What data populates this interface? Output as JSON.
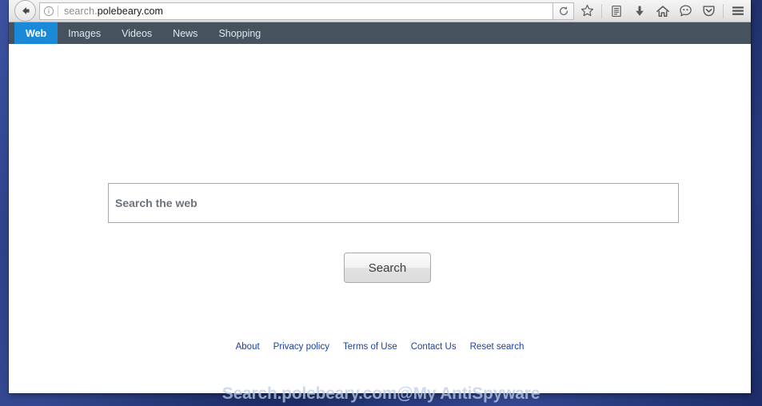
{
  "browser": {
    "back_label": "Back",
    "url_prefix": "search.",
    "url_domain": "polebeary.com",
    "url_full": "search.polebeary.com",
    "identity_icon": "info-circle-icon",
    "reload_icon": "reload-icon",
    "toolbar_icons": [
      {
        "name": "bookmark-star-icon",
        "label": "Bookmark this page"
      },
      {
        "name": "library-icon",
        "label": "Show your library"
      },
      {
        "name": "downloads-icon",
        "label": "Downloads"
      },
      {
        "name": "home-icon",
        "label": "Home"
      },
      {
        "name": "sync-icon",
        "label": "Sync"
      },
      {
        "name": "pocket-icon",
        "label": "Save to Pocket"
      },
      {
        "name": "menu-hamburger-icon",
        "label": "Open menu"
      }
    ]
  },
  "site_nav": {
    "items": [
      {
        "label": "Web",
        "active": true
      },
      {
        "label": "Images",
        "active": false
      },
      {
        "label": "Videos",
        "active": false
      },
      {
        "label": "News",
        "active": false
      },
      {
        "label": "Shopping",
        "active": false
      }
    ]
  },
  "search": {
    "placeholder": "Search the web",
    "value": "",
    "button_label": "Search"
  },
  "footer": {
    "links": [
      "About",
      "Privacy policy",
      "Terms of Use",
      "Contact Us",
      "Reset search"
    ]
  },
  "watermark": {
    "text": "Search.polebeary.com@My AntiSpyware"
  },
  "colors": {
    "nav_bar": "#46525e",
    "nav_active": "#1a8ad8",
    "link": "#1a3faa",
    "desktop": "#253a86"
  }
}
